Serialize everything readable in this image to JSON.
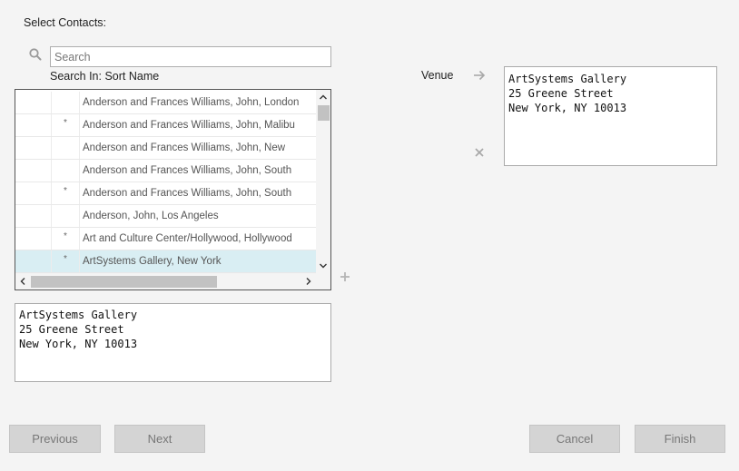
{
  "heading": "Select Contacts:",
  "search": {
    "placeholder": "Search",
    "value": ""
  },
  "search_in": "Search In: Sort Name",
  "contacts": [
    {
      "mark": "",
      "name": "Anderson and Frances Williams, John, London",
      "selected": false
    },
    {
      "mark": "*",
      "name": "Anderson and Frances Williams, John, Malibu",
      "selected": false
    },
    {
      "mark": "",
      "name": "Anderson and Frances Williams, John, New",
      "selected": false
    },
    {
      "mark": "",
      "name": "Anderson and Frances Williams, John, South",
      "selected": false
    },
    {
      "mark": "*",
      "name": "Anderson and Frances Williams, John, South",
      "selected": false
    },
    {
      "mark": "",
      "name": "Anderson, John, Los Angeles",
      "selected": false
    },
    {
      "mark": "*",
      "name": "Art and Culture Center/Hollywood, Hollywood",
      "selected": false
    },
    {
      "mark": "*",
      "name": "ArtSystems Gallery, New York",
      "selected": true
    }
  ],
  "address_preview": "ArtSystems Gallery\n25 Greene Street\nNew York, NY 10013",
  "venue": {
    "label": "Venue",
    "address": "ArtSystems Gallery\n25 Greene Street\nNew York, NY 10013"
  },
  "buttons": {
    "previous": "Previous",
    "next": "Next",
    "cancel": "Cancel",
    "finish": "Finish"
  },
  "icons": {
    "search": "search-icon",
    "plus": "plus-icon",
    "arrow": "arrow-right-icon",
    "remove": "close-icon"
  },
  "colors": {
    "selected_row": "#d9eef3",
    "button_bg": "#d4d4d4",
    "button_text": "#777777"
  }
}
